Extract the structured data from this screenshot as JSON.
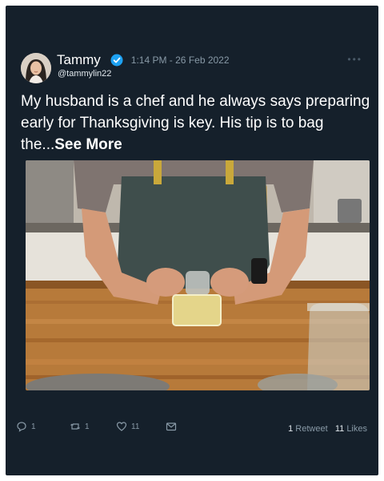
{
  "author": {
    "display_name": "Tammy",
    "handle": "@tammylin22",
    "verified": true,
    "timestamp": "1:14 PM - 26 Feb 2022"
  },
  "tweet": {
    "text": "My husband is a chef and he always says preparing early for Thanksgiving is key. His tip is to bag the...",
    "see_more": "See More"
  },
  "media": {
    "icon": "photo-of-chef-wrapping-food"
  },
  "actions": {
    "reply_count": "1",
    "retweet_count": "1",
    "like_count": "11"
  },
  "stats": {
    "retweets_value": "1",
    "retweets_label": "Retweet",
    "likes_value": "11",
    "likes_label": "Likes"
  },
  "colors": {
    "background": "#15202b",
    "verified_badge": "#1da1f2",
    "secondary_text": "#8899a6"
  }
}
